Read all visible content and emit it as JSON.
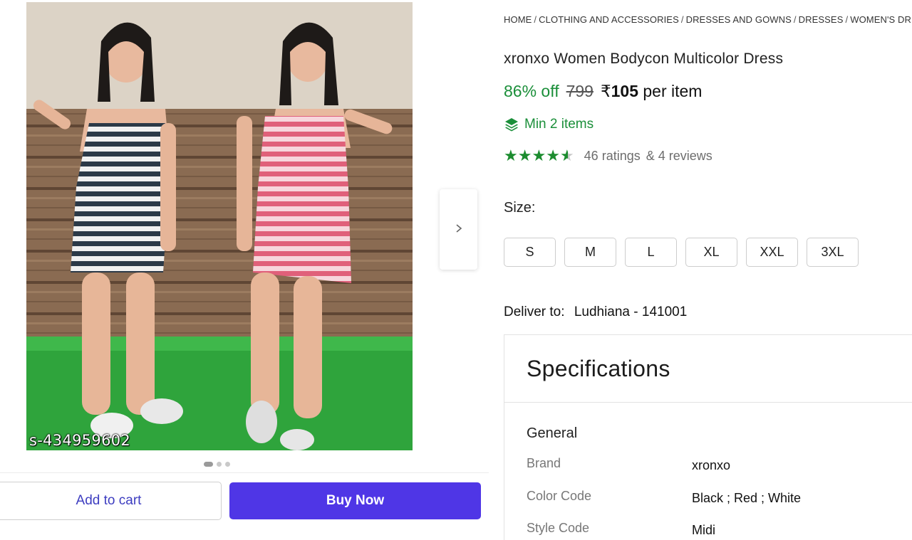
{
  "image": {
    "sku_watermark": "s-434959602",
    "carousel": {
      "count": 3,
      "active_index": 0
    }
  },
  "actions": {
    "add_to_cart": "Add to cart",
    "buy_now": "Buy Now"
  },
  "breadcrumb": [
    "HOME",
    "CLOTHING AND ACCESSORIES",
    "DRESSES AND GOWNS",
    "DRESSES",
    "WOMEN'S DRESSES"
  ],
  "product": {
    "title": "xronxo Women Bodycon Multicolor Dress",
    "discount": "86% off",
    "mrp": "799",
    "price_symbol": "₹",
    "price_amount": "105",
    "price_suffix": "per item",
    "min_items": "Min 2 items",
    "rating_value": 4.5,
    "ratings_text": "46 ratings",
    "reviews_text": "& 4 reviews"
  },
  "size": {
    "label": "Size:",
    "options": [
      "S",
      "M",
      "L",
      "XL",
      "XXL",
      "3XL"
    ]
  },
  "delivery": {
    "label": "Deliver to:",
    "location": "Ludhiana - 141001"
  },
  "specifications": {
    "title": "Specifications",
    "section": "General",
    "rows": [
      {
        "key": "Brand",
        "value": "xronxo"
      },
      {
        "key": "Color Code",
        "value": "Black ; Red ; White"
      },
      {
        "key": "Style Code",
        "value": "Midi"
      }
    ]
  },
  "colors": {
    "accent_purple": "#4f36e6",
    "link_purple": "#3d3dc0",
    "green": "#1b8f3a"
  }
}
